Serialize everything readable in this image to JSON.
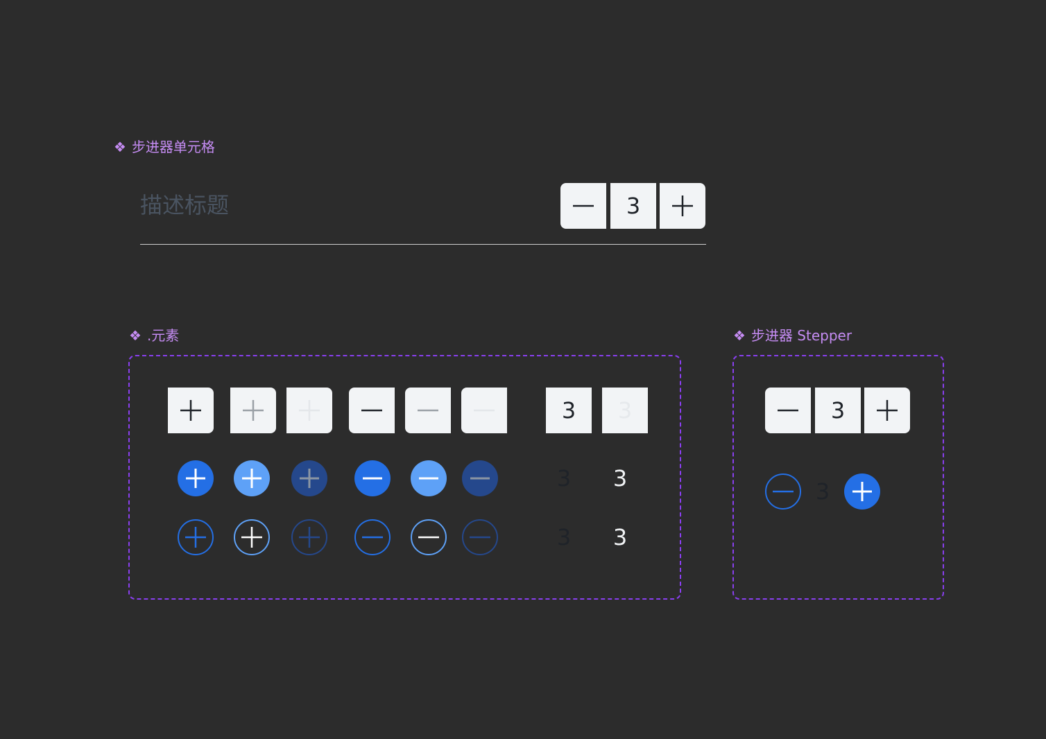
{
  "components": {
    "stepper_cell": {
      "title_icon": "component-icon",
      "title": "步进器单元格",
      "label": "描述标题",
      "value": "3"
    },
    "elements": {
      "title_icon": "component-icon",
      "title": ".元素",
      "number_value": "3"
    },
    "stepper": {
      "title_icon": "component-icon",
      "title": "步进器 Stepper",
      "value": "3"
    }
  },
  "glyphs": {
    "component": "❖"
  },
  "colors": {
    "background": "#2c2c2c",
    "component_title": "#c58cf3",
    "frame_border": "#8a3ff0",
    "button_bg": "#f2f4f6",
    "primary_blue": "#246fe5",
    "light_blue": "#5ea1f7",
    "dark_blue": "#25488c"
  }
}
